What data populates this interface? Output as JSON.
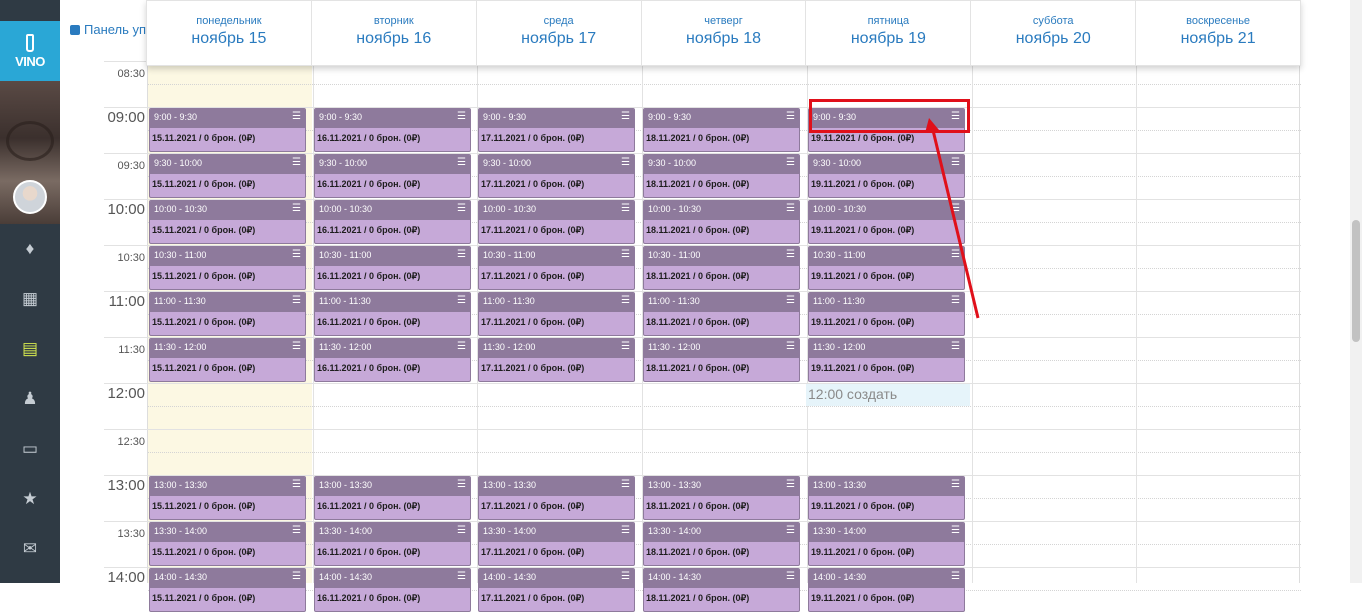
{
  "sidebar": {
    "logo_text": "VINO",
    "icons": [
      "bottle-icon",
      "calendar-icon",
      "list-icon",
      "users-icon",
      "window-icon",
      "star-icon",
      "mail-icon"
    ],
    "active_icon": "list-icon"
  },
  "topbar": {
    "panel_link": "Панель упр"
  },
  "days": [
    {
      "weekday": "понедельник",
      "date": "ноябрь 15",
      "events_date": "15.11.2021"
    },
    {
      "weekday": "вторник",
      "date": "ноябрь 16",
      "events_date": "16.11.2021"
    },
    {
      "weekday": "среда",
      "date": "ноябрь 17",
      "events_date": "17.11.2021"
    },
    {
      "weekday": "четверг",
      "date": "ноябрь 18",
      "events_date": "18.11.2021"
    },
    {
      "weekday": "пятница",
      "date": "ноябрь 19",
      "events_date": "19.11.2021"
    },
    {
      "weekday": "суббота",
      "date": "ноябрь 20",
      "events_date": ""
    },
    {
      "weekday": "воскресенье",
      "date": "ноябрь 21",
      "events_date": ""
    }
  ],
  "times": [
    "08:30",
    "09:00",
    "09:30",
    "10:00",
    "10:30",
    "11:00",
    "11:30",
    "12:00",
    "12:30",
    "13:00",
    "13:30",
    "14:00"
  ],
  "slots": [
    "9:00 - 9:30",
    "9:30 - 10:00",
    "10:00 - 10:30",
    "10:30 - 11:00",
    "11:00 - 11:30",
    "11:30 - 12:00",
    "13:00 - 13:30",
    "13:30 - 14:00",
    "14:00 - 14:30"
  ],
  "booking_suffix": " / 0 брон. (0₽)",
  "create_label": "12:00 создать",
  "colors": {
    "event_head": "#8e7a9c",
    "event_body": "#c6a9d8",
    "today_bg": "#fcf8e3",
    "accent": "#2a7bbf",
    "highlight": "#e0101a"
  }
}
